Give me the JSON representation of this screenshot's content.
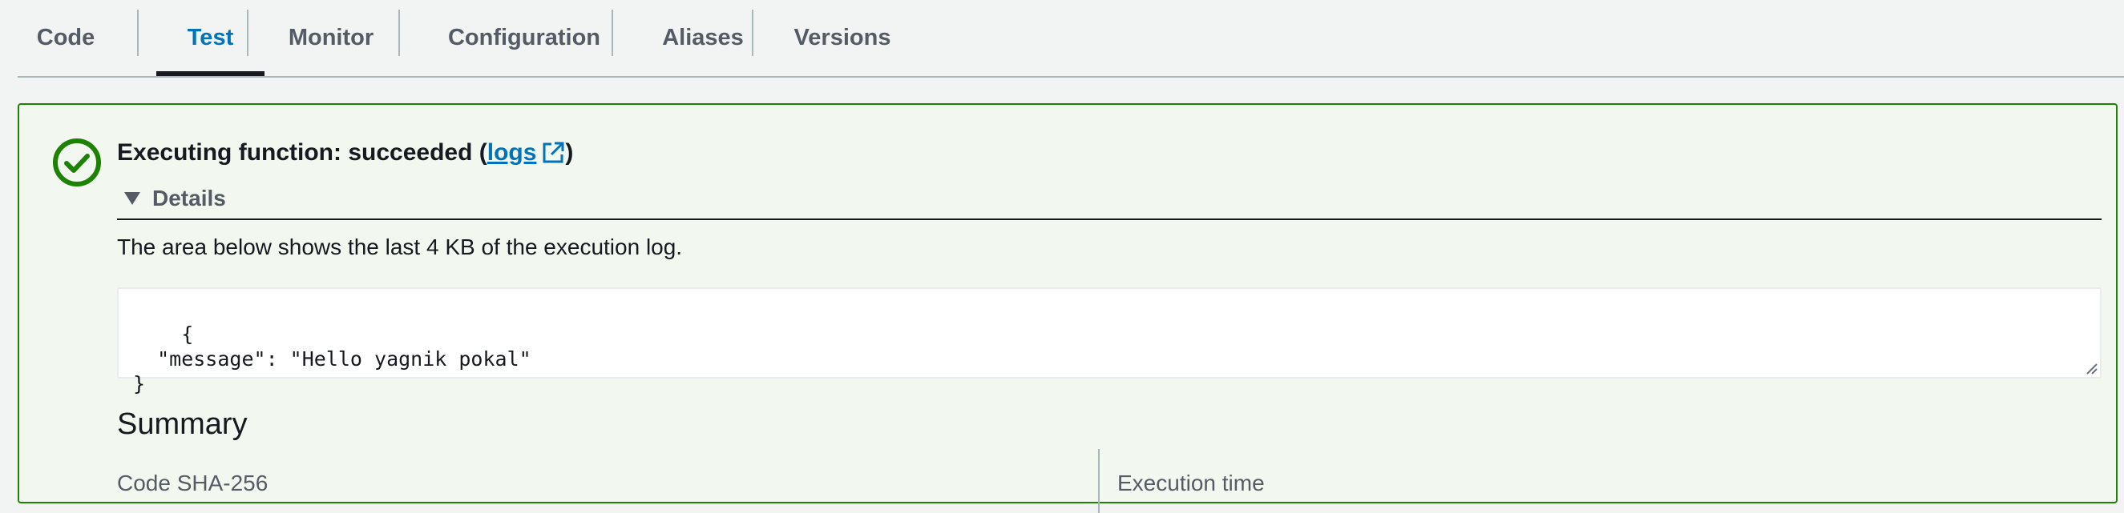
{
  "tabs": [
    {
      "label": "Code"
    },
    {
      "label": "Test"
    },
    {
      "label": "Monitor"
    },
    {
      "label": "Configuration"
    },
    {
      "label": "Aliases"
    },
    {
      "label": "Versions"
    }
  ],
  "active_tab": "Test",
  "result": {
    "status_prefix": "Executing function: succeeded (",
    "logs_link": "logs",
    "status_suffix": ")",
    "details_label": "Details",
    "description": "The area below shows the last 4 KB of the execution log.",
    "log_output": "{\n  \"message\": \"Hello yagnik pokal\"\n}"
  },
  "summary": {
    "title": "Summary",
    "code_sha_label": "Code SHA-256",
    "execution_time_label": "Execution time"
  },
  "colors": {
    "success": "#1d8102",
    "link": "#0073bb",
    "panel_bg": "#f2f8f0"
  },
  "icons": {
    "status": "success-check-circle-icon",
    "logs": "external-link-icon",
    "details": "caret-down-icon"
  }
}
